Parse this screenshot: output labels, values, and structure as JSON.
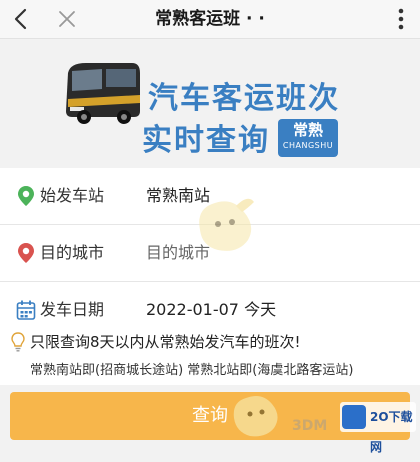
{
  "header": {
    "title": "常熟客运班 · ·"
  },
  "banner": {
    "line1": "汽车客运班次",
    "line2": "实时查询",
    "badge_cn": "常熟",
    "badge_en": "CHANGSHU"
  },
  "form": {
    "departure_station": {
      "label": "始发车站",
      "value": "常熟南站"
    },
    "destination_city": {
      "label": "目的城市",
      "placeholder": "目的城市"
    },
    "departure_date": {
      "label": "发车日期",
      "value": "2022-01-07 今天"
    }
  },
  "notes": {
    "line1": "只限查询8天以内从常熟始发汽车的班次!",
    "line2": "常熟南站即(招商城长途站) 常熟北站即(海虞北路客运站)"
  },
  "query_button": {
    "label": "查询"
  },
  "watermark": {
    "logo_text": "2O下载网",
    "site_text": "3DM"
  },
  "colors": {
    "brand_blue": "#3a7fc2",
    "button_orange": "#f7b64b",
    "pin_green": "#4cb35a",
    "pin_red": "#d9534f",
    "calendar_blue": "#3a7fc2"
  },
  "icons": {
    "back": "chevron-left-icon",
    "close": "close-icon",
    "more": "more-dots-icon",
    "departure": "green-location-pin-icon",
    "destination": "red-location-pin-icon",
    "date": "calendar-icon",
    "tip": "lightbulb-icon"
  }
}
